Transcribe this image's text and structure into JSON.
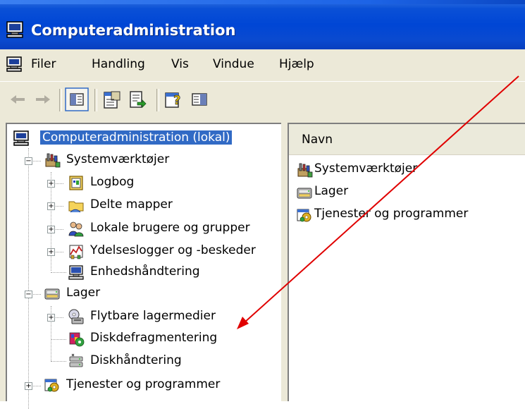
{
  "window": {
    "title": "Computeradministration"
  },
  "menu": {
    "items": [
      "Filer",
      "Handling",
      "Vis",
      "Vindue",
      "Hjælp"
    ]
  },
  "toolbar": {
    "buttons": [
      "back-arrow-icon",
      "forward-arrow-icon",
      "show-hide-tree-icon",
      "properties-icon",
      "export-list-icon",
      "help-icon",
      "action-pane-icon"
    ]
  },
  "tree": {
    "root": "Computeradministration (lokal)",
    "system_tools": "Systemværktøjer",
    "system_tools_children": [
      "Logbog",
      "Delte mapper",
      "Lokale brugere og grupper",
      "Ydelseslogger og -beskeder",
      "Enhedshåndtering"
    ],
    "storage": "Lager",
    "storage_children": [
      "Flytbare lagermedier",
      "Diskdefragmentering",
      "Diskhåndtering"
    ],
    "services": "Tjenester og programmer"
  },
  "list": {
    "column_header": "Navn",
    "items": [
      "Systemværktøjer",
      "Lager",
      "Tjenester og programmer"
    ]
  },
  "colors": {
    "titlebar": "#0046d5",
    "selection": "#316ac5",
    "annotation_arrow": "#e00000"
  }
}
